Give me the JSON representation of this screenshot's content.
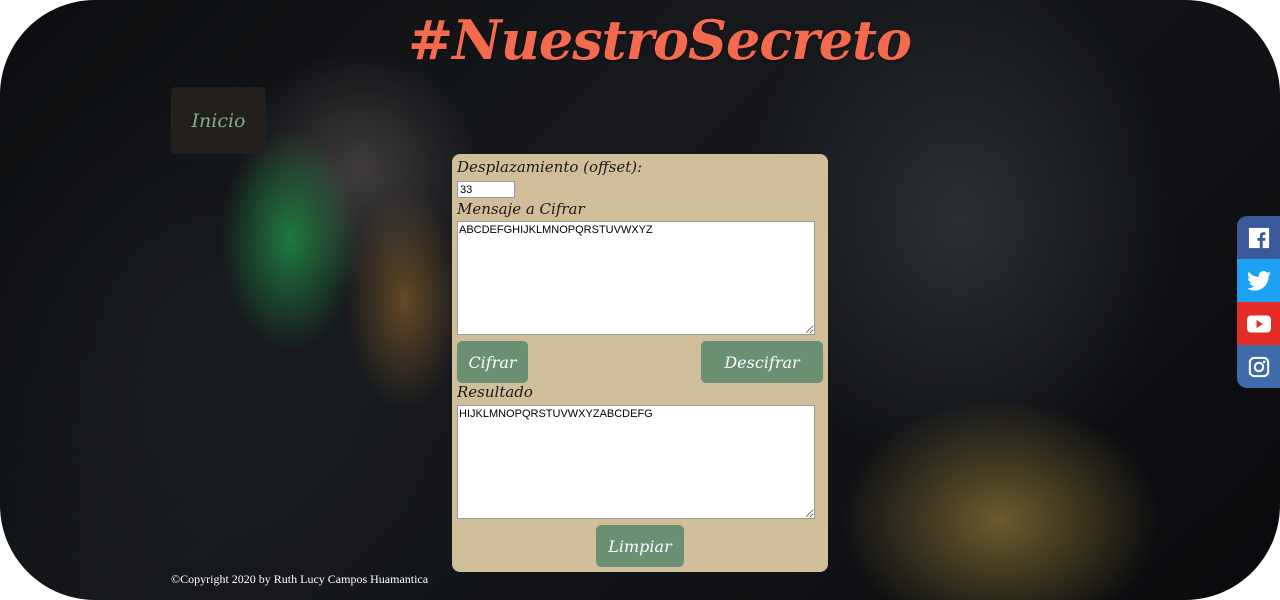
{
  "header": {
    "title": "#NuestroSecreto"
  },
  "nav": {
    "inicio_label": "Inicio"
  },
  "form": {
    "offset_label": "Desplazamiento (offset):",
    "offset_value": "33",
    "message_label": "Mensaje a Cifrar",
    "message_value": "ABCDEFGHIJKLMNOPQRSTUVWXYZ",
    "cifrar_label": "Cifrar",
    "descifrar_label": "Descifrar",
    "result_label": "Resultado",
    "result_value": "HIJKLMNOPQRSTUVWXYZABCDEFG",
    "limpiar_label": "Limpiar"
  },
  "footer": {
    "copyright": "©Copyright 2020 by Ruth Lucy Campos Huamantica"
  },
  "social": [
    {
      "name": "facebook-icon",
      "color": "#3b5998"
    },
    {
      "name": "twitter-icon",
      "color": "#1da1f2"
    },
    {
      "name": "youtube-icon",
      "color": "#e52d27"
    },
    {
      "name": "instagram-icon",
      "color": "#3f6ca8"
    }
  ]
}
